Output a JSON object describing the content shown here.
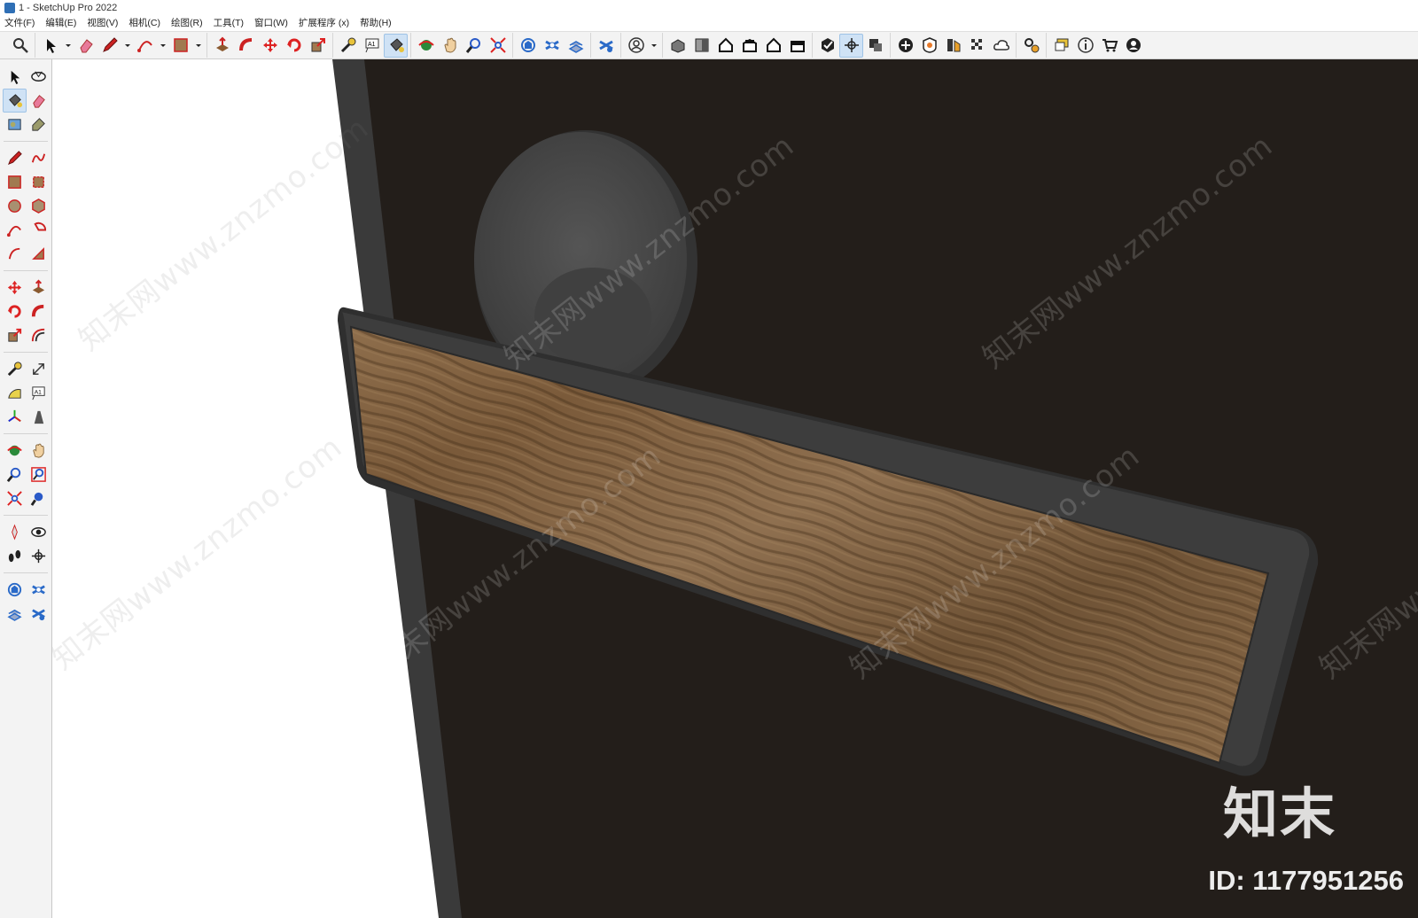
{
  "window": {
    "title": "1 - SketchUp Pro 2022"
  },
  "menu": [
    "文件(F)",
    "编辑(E)",
    "视图(V)",
    "相机(C)",
    "绘图(R)",
    "工具(T)",
    "窗口(W)",
    "扩展程序 (x)",
    "帮助(H)"
  ],
  "toolbar": {
    "groups": [
      [
        "search-icon"
      ],
      [
        "select-icon",
        "dropdown-icon",
        "eraser-icon",
        "pencil-icon",
        "dropdown-icon",
        "arc-icon",
        "dropdown-icon",
        "rectangle-icon",
        "dropdown-icon"
      ],
      [
        "push-pull-icon",
        "follow-me-icon",
        "move-icon",
        "rotate-icon",
        "scale-icon"
      ],
      [
        "tape-measure-icon",
        "text-icon",
        "paint-bucket-icon"
      ],
      [
        "orbit-icon",
        "pan-icon",
        "zoom-icon",
        "zoom-extents-icon"
      ],
      [
        "warehouse-icon",
        "extension-warehouse-icon",
        "layout-icon"
      ],
      [
        "extension-manager-icon"
      ],
      [
        "account-icon",
        "dropdown-icon"
      ],
      [
        "iso-view-icon",
        "top-view-icon",
        "front-view-icon",
        "right-view-icon",
        "back-view-icon",
        "left-view-icon"
      ],
      [
        "solid-inspector-icon",
        "section-plane-icon",
        "section-cut-icon"
      ],
      [
        "add-location-icon",
        "shadow-icon",
        "styles-icon",
        "x-ray-icon",
        "cloud-icon"
      ],
      [
        "settings-icon"
      ],
      [
        "comment-icon",
        "info-icon",
        "cart-icon",
        "user-icon"
      ]
    ],
    "active": [
      "paint-bucket-icon",
      "section-plane-icon"
    ]
  },
  "left_toolbar": {
    "rows": [
      [
        "select-icon",
        "orbit-3d-icon"
      ],
      [
        "paint-bucket-icon",
        "eraser-icon"
      ],
      [
        "component-icon",
        "tag-icon"
      ],
      "sep",
      [
        "line-icon",
        "freehand-icon"
      ],
      [
        "rectangle-icon",
        "rotated-rectangle-icon"
      ],
      [
        "circle-icon",
        "polygon-icon"
      ],
      [
        "arc-icon",
        "pie-icon"
      ],
      [
        "two-point-arc-icon",
        "three-point-arc-icon"
      ],
      "sep",
      [
        "move-icon",
        "push-pull-icon"
      ],
      [
        "rotate-icon",
        "follow-me-icon"
      ],
      [
        "scale-icon",
        "offset-icon"
      ],
      "sep",
      [
        "tape-measure-icon",
        "dimension-icon"
      ],
      [
        "protractor-icon",
        "text-icon"
      ],
      [
        "axes-icon",
        "3d-text-icon"
      ],
      "sep",
      [
        "orbit-icon",
        "pan-icon"
      ],
      [
        "zoom-icon",
        "zoom-window-icon"
      ],
      [
        "zoom-extents-icon",
        "previous-view-icon"
      ],
      "sep",
      [
        "position-camera-icon",
        "look-around-icon"
      ],
      [
        "walk-icon",
        "section-plane-icon"
      ],
      "sep",
      [
        "warehouse-icon",
        "extension-warehouse-icon"
      ],
      [
        "layout-icon",
        "extension-manager-icon"
      ]
    ],
    "active": [
      "paint-bucket-icon"
    ]
  },
  "watermark": {
    "text": "知末网www.znzmo.com",
    "brand": "知末",
    "id": "ID: 1177951256"
  },
  "colors": {
    "door": "#231e1a",
    "frame": "#3a3a3a",
    "handle_frame": "#3d3d3d",
    "wood": "#8a6a48",
    "rosette": "#4a4a4a",
    "accent": "#cfe2f5"
  }
}
